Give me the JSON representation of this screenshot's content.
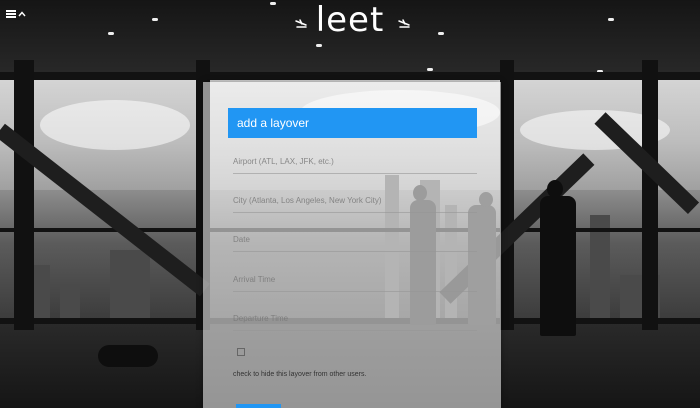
{
  "header": {
    "logo_text": "leet",
    "menu_icon": "hamburger-menu-icon",
    "menu_caret_icon": "caret-up-icon",
    "left_ornament_icon": "airplane-landing-icon",
    "right_ornament_icon": "airplane-landing-icon"
  },
  "form": {
    "title": "add a layover",
    "fields": {
      "airport_placeholder": "Airport (ATL, LAX, JFK, etc.)",
      "city_placeholder": "City (Atlanta, Los Angeles, New York City)",
      "date_placeholder": "Date",
      "arrival_placeholder": "Arrival Time",
      "departure_placeholder": "Departure Time"
    },
    "hide_checkbox_label": "check to hide this layover from other users.",
    "hide_checked": false
  },
  "colors": {
    "accent": "#2196f3",
    "text_on_accent": "#ffffff"
  }
}
